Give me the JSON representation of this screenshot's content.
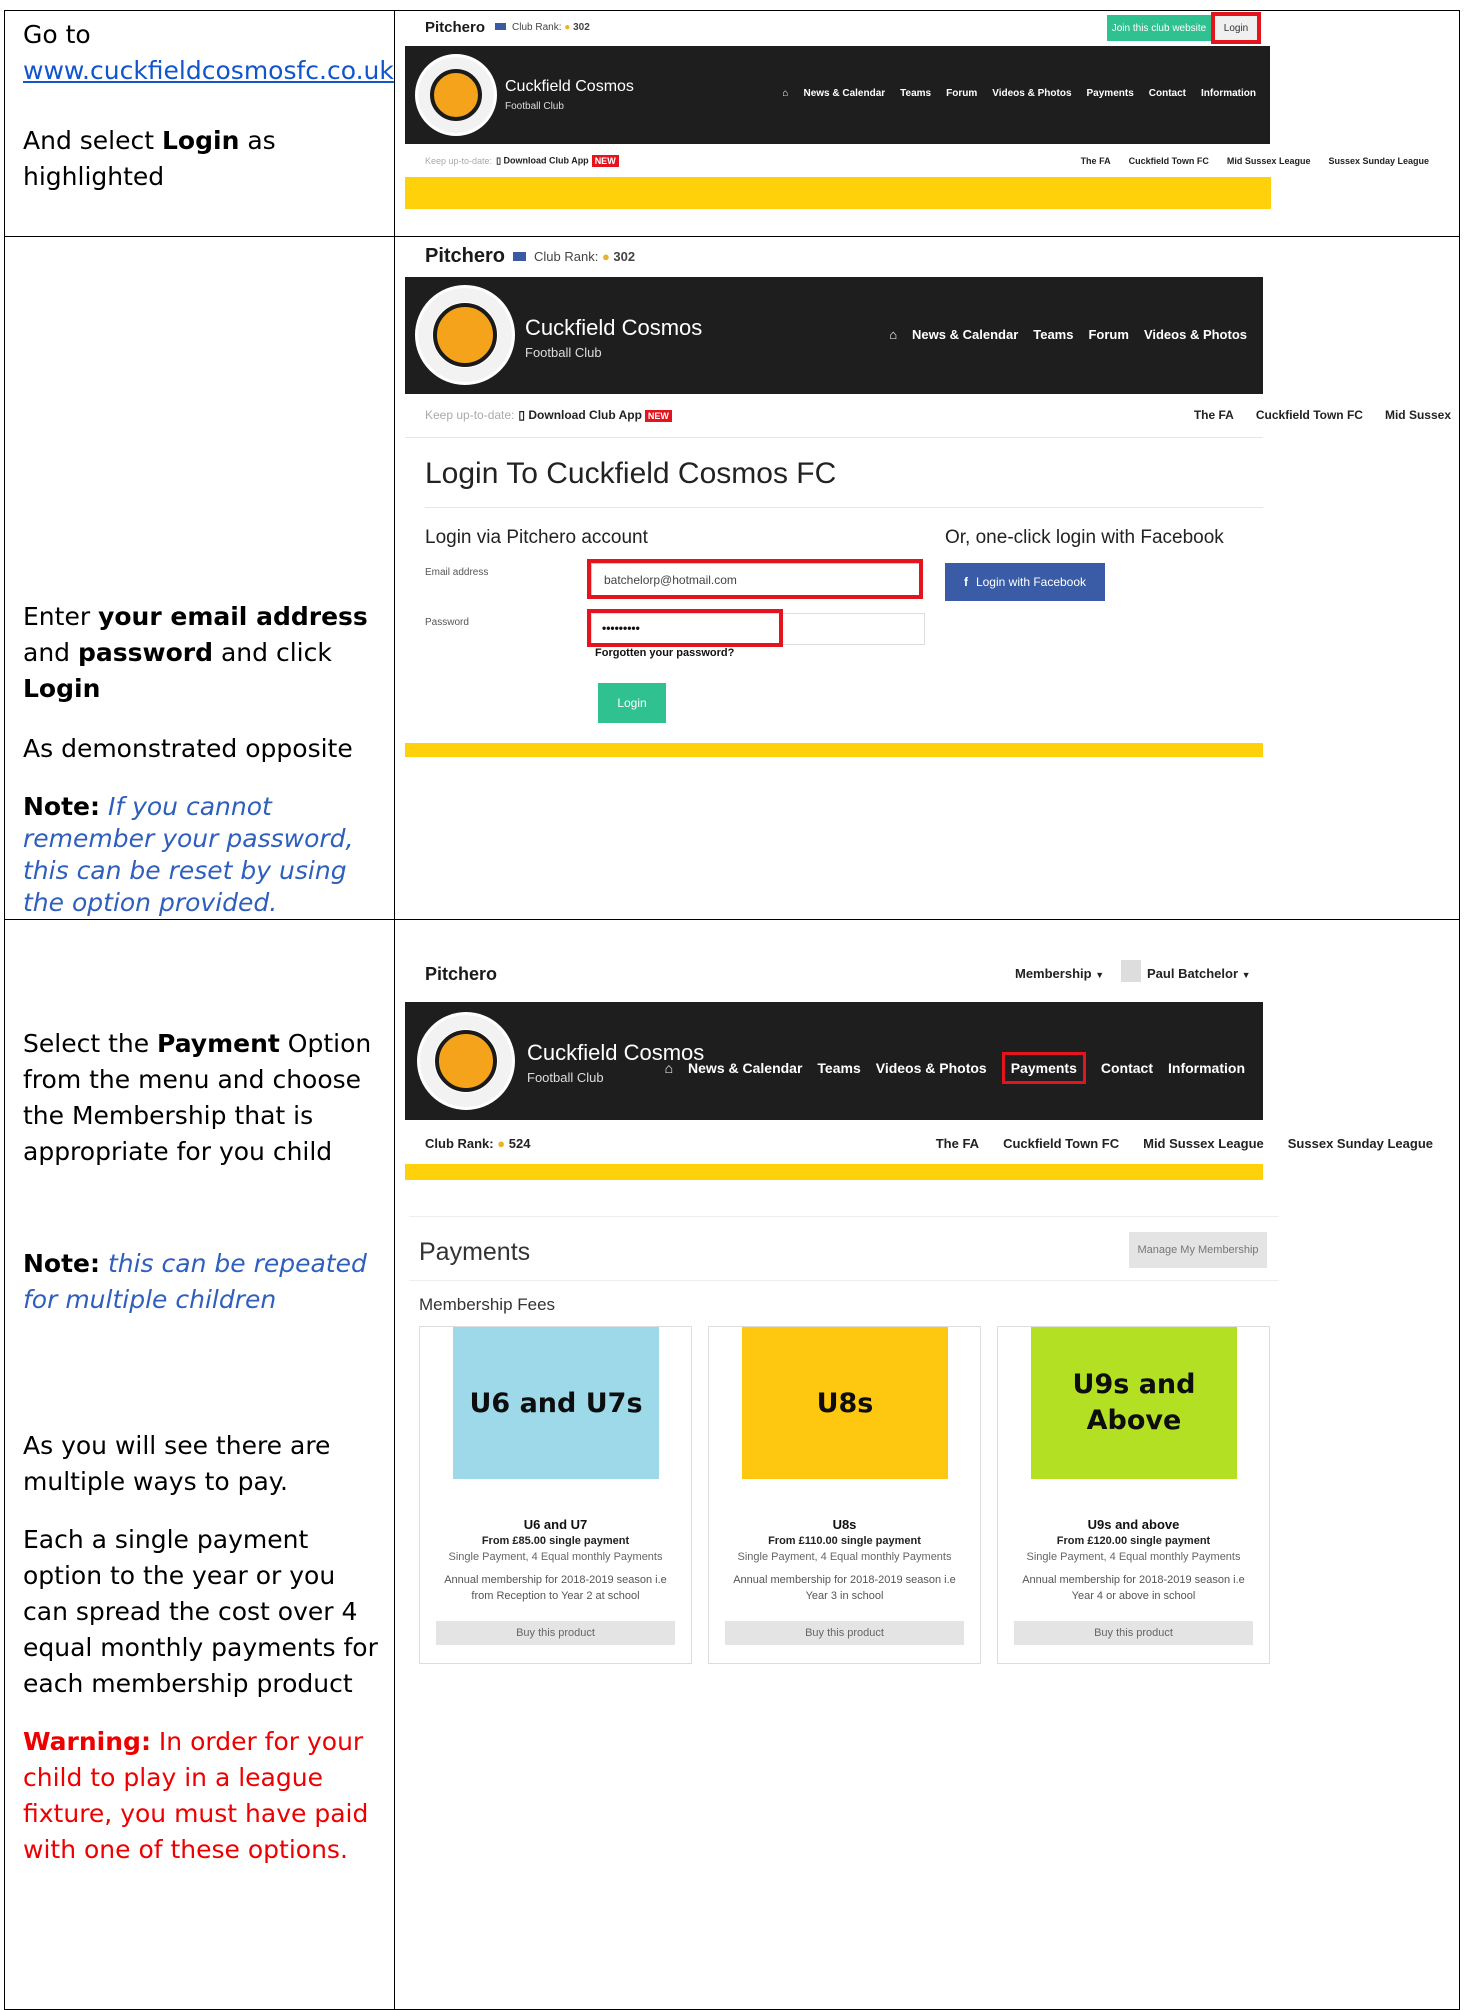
{
  "steps": [
    {
      "instruction": {
        "go_to": "Go to",
        "url": "www.cuckfieldcosmosfc.co.uk",
        "and_select": "And select ",
        "login_bold": "Login",
        "as_highlighted": " as highlighted"
      },
      "shot": {
        "brand": "Pitchero",
        "club_rank_label": "Club Rank:",
        "club_rank_value": "302",
        "join_button": "Join this club website",
        "login_button": "Login",
        "club_name": "Cuckfield Cosmos",
        "club_sub": "Football Club",
        "nav": [
          "News & Calendar",
          "Teams",
          "Forum",
          "Videos & Photos",
          "Payments",
          "Contact",
          "Information"
        ],
        "keep_up": "Keep up-to-date:",
        "download_app": "Download Club App",
        "new_badge": "NEW",
        "links": [
          "The FA",
          "Cuckfield Town FC",
          "Mid Sussex League",
          "Sussex Sunday League"
        ]
      }
    },
    {
      "instruction": {
        "enter": "Enter ",
        "email_bold": "your email address",
        "and": " and ",
        "password_bold": "password",
        "and_click": " and click ",
        "login_bold": "Login",
        "as_demo": "As demonstrated opposite",
        "note_label": "Note:",
        "note_text": " If you cannot remember your password, this can be reset by using the option provided."
      },
      "shot": {
        "brand": "Pitchero",
        "club_rank_label": "Club Rank:",
        "club_rank_value": "302",
        "club_name": "Cuckfield Cosmos",
        "club_sub": "Football Club",
        "nav": [
          "News & Calendar",
          "Teams",
          "Forum",
          "Videos & Photos"
        ],
        "keep_up": "Keep up-to-date:",
        "download_app": "Download Club App",
        "new_badge": "NEW",
        "links": [
          "The FA",
          "Cuckfield Town FC",
          "Mid Sussex"
        ],
        "login_title": "Login To Cuckfield Cosmos FC",
        "via_pitchero": "Login via Pitchero account",
        "via_facebook": "Or, one-click login with Facebook",
        "email_label": "Email address",
        "email_value": "batchelorp@hotmail.com",
        "password_label": "Password",
        "password_value": "•••••••••",
        "forgot": "Forgotten your password?",
        "facebook_button": "Login with Facebook",
        "login_button": "Login"
      }
    },
    {
      "instruction": {
        "select_the": "Select the ",
        "payment_bold": "Payment",
        "rest": " Option from the menu and choose the Membership that is appropriate for you child",
        "note_label": "Note:",
        "note_text": "  this can be repeated for multiple children",
        "multiple_ways": "As you will see there are multiple ways to pay.",
        "each": "Each a single payment option to the year or you can spread the cost over 4 equal monthly payments for each membership product",
        "warning_label": "Warning:",
        "warning_text": " In order for your child to play in a league fixture, you must have paid with one of these options."
      },
      "shot": {
        "brand": "Pitchero",
        "membership_menu": "Membership",
        "user_name": "Paul Batchelor",
        "club_name": "Cuckfield Cosmos",
        "club_sub": "Football Club",
        "nav": [
          "News & Calendar",
          "Teams",
          "Videos & Photos",
          "Payments",
          "Contact",
          "Information"
        ],
        "club_rank_label": "Club Rank:",
        "club_rank_value": "524",
        "links": [
          "The FA",
          "Cuckfield Town FC",
          "Mid Sussex League",
          "Sussex Sunday League"
        ],
        "payments_title": "Payments",
        "manage_button": "Manage My Membership",
        "fees_heading": "Membership Fees",
        "cards": [
          {
            "image_text": "U6 and U7s",
            "color": "#9ed9ea",
            "title": "U6 and U7",
            "from": "From £85.00 single payment",
            "options": "Single Payment, 4 Equal monthly Payments",
            "desc": "Annual membership for 2018-2019 season i.e from Reception to Year 2 at school",
            "button": "Buy this product"
          },
          {
            "image_text": "U8s",
            "color": "#fdc80f",
            "title": "U8s",
            "from": "From £110.00 single payment",
            "options": "Single Payment, 4 Equal monthly Payments",
            "desc": "Annual membership for 2018-2019 season i.e Year 3 in school",
            "button": "Buy this product"
          },
          {
            "image_text": "U9s and Above",
            "color": "#b4e024",
            "title": "U9s and above",
            "from": "From £120.00 single payment",
            "options": "Single Payment, 4 Equal monthly Payments",
            "desc": "Annual membership for 2018-2019 season i.e Year 4 or above in school",
            "button": "Buy this product"
          }
        ]
      }
    }
  ],
  "colors": {
    "green": "#2fc18f",
    "yellow": "#ffd10a",
    "highlight_red": "#e3141e",
    "facebook": "#3a5ba5",
    "link_blue": "#1155cc"
  }
}
